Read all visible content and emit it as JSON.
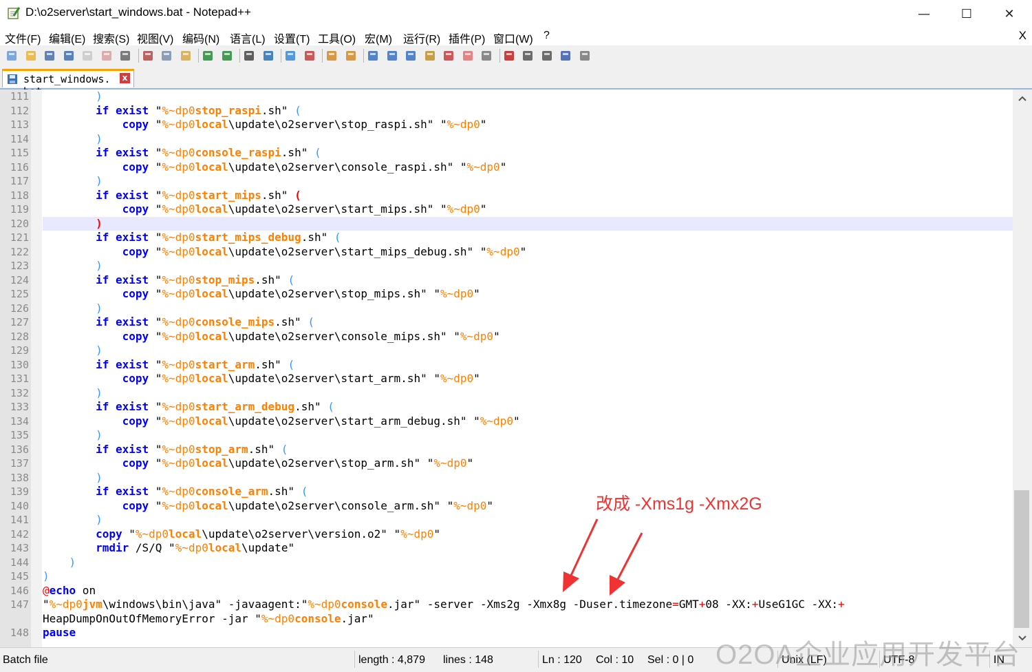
{
  "window": {
    "title": "D:\\o2server\\start_windows.bat - Notepad++",
    "app_icon": "notepadpp-icon",
    "controls": {
      "minimize": "—",
      "maximize": "☐",
      "close": "✕"
    }
  },
  "menu": {
    "items": [
      "文件(F)",
      "编辑(E)",
      "搜索(S)",
      "视图(V)",
      "编码(N)",
      "语言(L)",
      "设置(T)",
      "工具(O)",
      "宏(M)",
      "运行(R)",
      "插件(P)",
      "窗口(W)",
      "?"
    ],
    "close": "X"
  },
  "toolbar": {
    "icons": [
      "new-file-icon",
      "open-file-icon",
      "save-icon",
      "save-all-icon",
      "close-icon",
      "close-all-icon",
      "print-icon",
      "cut-icon",
      "copy-icon",
      "paste-icon",
      "undo-icon",
      "redo-icon",
      "find-icon",
      "replace-icon",
      "zoom-in-icon",
      "zoom-out-icon",
      "sync-vertical-icon",
      "sync-horizontal-icon",
      "word-wrap-icon",
      "show-all-chars-icon",
      "indent-guide-icon",
      "doc-map-icon",
      "function-list-icon",
      "folder-workspace-icon",
      "monitor-icon",
      "record-macro-icon",
      "stop-record-icon",
      "play-macro-icon",
      "run-macro-multiple-icon",
      "save-macro-icon"
    ]
  },
  "tab": {
    "label": "start_windows. bat",
    "close": "x"
  },
  "annotation": "改成 -Xms1g -Xmx2G",
  "watermark": "O2OA企业应用开发平台",
  "status": {
    "file_type": "Batch file",
    "length": "length : 4,879",
    "lines": "lines : 148",
    "ln": "Ln : 120",
    "col": "Col : 10",
    "sel": "Sel : 0 | 0",
    "eol": "Unix (LF)",
    "encoding": "UTF-8",
    "mode": "IN"
  },
  "colors": {
    "keyword": "#0000ff",
    "variable": "#ff8000",
    "operator": "#ff0000",
    "paren": "#3399ff",
    "annotation": "#f03232"
  },
  "editor": {
    "lines": [
      {
        "n": "111",
        "t": [
          [
            "",
            "        "
          ],
          [
            "p",
            ")"
          ]
        ]
      },
      {
        "n": "112",
        "t": [
          [
            "",
            "        "
          ],
          [
            "kw",
            "if exist"
          ],
          [
            "",
            " \""
          ],
          [
            "var",
            "%~dp0"
          ],
          [
            "varb",
            "stop_raspi"
          ],
          [
            "",
            ".sh\" "
          ],
          [
            "p",
            "("
          ]
        ]
      },
      {
        "n": "113",
        "t": [
          [
            "",
            "            "
          ],
          [
            "kw",
            "copy"
          ],
          [
            "",
            " \""
          ],
          [
            "var",
            "%~dp0"
          ],
          [
            "varb",
            "local"
          ],
          [
            "",
            "\\update\\o2server\\stop_raspi.sh\" \""
          ],
          [
            "var",
            "%~dp0"
          ],
          [
            "",
            "\""
          ]
        ]
      },
      {
        "n": "114",
        "t": [
          [
            "",
            "        "
          ],
          [
            "p",
            ")"
          ]
        ]
      },
      {
        "n": "115",
        "t": [
          [
            "",
            "        "
          ],
          [
            "kw",
            "if exist"
          ],
          [
            "",
            " \""
          ],
          [
            "var",
            "%~dp0"
          ],
          [
            "varb",
            "console_raspi"
          ],
          [
            "",
            ".sh\" "
          ],
          [
            "p",
            "("
          ]
        ]
      },
      {
        "n": "116",
        "t": [
          [
            "",
            "            "
          ],
          [
            "kw",
            "copy"
          ],
          [
            "",
            " \""
          ],
          [
            "var",
            "%~dp0"
          ],
          [
            "varb",
            "local"
          ],
          [
            "",
            "\\update\\o2server\\console_raspi.sh\" \""
          ],
          [
            "var",
            "%~dp0"
          ],
          [
            "",
            "\""
          ]
        ]
      },
      {
        "n": "117",
        "t": [
          [
            "",
            "        "
          ],
          [
            "p",
            ")"
          ]
        ]
      },
      {
        "n": "118",
        "t": [
          [
            "",
            "        "
          ],
          [
            "kw",
            "if exist"
          ],
          [
            "",
            " \""
          ],
          [
            "var",
            "%~dp0"
          ],
          [
            "varb",
            "start_mips"
          ],
          [
            "",
            ".sh\" "
          ],
          [
            "pr",
            "("
          ]
        ]
      },
      {
        "n": "119",
        "t": [
          [
            "",
            "            "
          ],
          [
            "kw",
            "copy"
          ],
          [
            "",
            " \""
          ],
          [
            "var",
            "%~dp0"
          ],
          [
            "varb",
            "local"
          ],
          [
            "",
            "\\update\\o2server\\start_mips.sh\" \""
          ],
          [
            "var",
            "%~dp0"
          ],
          [
            "",
            "\""
          ]
        ]
      },
      {
        "n": "120",
        "t": [
          [
            "",
            "        "
          ],
          [
            "pr",
            ")"
          ]
        ]
      },
      {
        "n": "121",
        "t": [
          [
            "",
            "        "
          ],
          [
            "kw",
            "if exist"
          ],
          [
            "",
            " \""
          ],
          [
            "var",
            "%~dp0"
          ],
          [
            "varb",
            "start_mips_debug"
          ],
          [
            "",
            ".sh\" "
          ],
          [
            "p",
            "("
          ]
        ]
      },
      {
        "n": "122",
        "t": [
          [
            "",
            "            "
          ],
          [
            "kw",
            "copy"
          ],
          [
            "",
            " \""
          ],
          [
            "var",
            "%~dp0"
          ],
          [
            "varb",
            "local"
          ],
          [
            "",
            "\\update\\o2server\\start_mips_debug.sh\" \""
          ],
          [
            "var",
            "%~dp0"
          ],
          [
            "",
            "\""
          ]
        ]
      },
      {
        "n": "123",
        "t": [
          [
            "",
            "        "
          ],
          [
            "p",
            ")"
          ]
        ]
      },
      {
        "n": "124",
        "t": [
          [
            "",
            "        "
          ],
          [
            "kw",
            "if exist"
          ],
          [
            "",
            " \""
          ],
          [
            "var",
            "%~dp0"
          ],
          [
            "varb",
            "stop_mips"
          ],
          [
            "",
            ".sh\" "
          ],
          [
            "p",
            "("
          ]
        ]
      },
      {
        "n": "125",
        "t": [
          [
            "",
            "            "
          ],
          [
            "kw",
            "copy"
          ],
          [
            "",
            " \""
          ],
          [
            "var",
            "%~dp0"
          ],
          [
            "varb",
            "local"
          ],
          [
            "",
            "\\update\\o2server\\stop_mips.sh\" \""
          ],
          [
            "var",
            "%~dp0"
          ],
          [
            "",
            "\""
          ]
        ]
      },
      {
        "n": "126",
        "t": [
          [
            "",
            "        "
          ],
          [
            "p",
            ")"
          ]
        ]
      },
      {
        "n": "127",
        "t": [
          [
            "",
            "        "
          ],
          [
            "kw",
            "if exist"
          ],
          [
            "",
            " \""
          ],
          [
            "var",
            "%~dp0"
          ],
          [
            "varb",
            "console_mips"
          ],
          [
            "",
            ".sh\" "
          ],
          [
            "p",
            "("
          ]
        ]
      },
      {
        "n": "128",
        "t": [
          [
            "",
            "            "
          ],
          [
            "kw",
            "copy"
          ],
          [
            "",
            " \""
          ],
          [
            "var",
            "%~dp0"
          ],
          [
            "varb",
            "local"
          ],
          [
            "",
            "\\update\\o2server\\console_mips.sh\" \""
          ],
          [
            "var",
            "%~dp0"
          ],
          [
            "",
            "\""
          ]
        ]
      },
      {
        "n": "129",
        "t": [
          [
            "",
            "        "
          ],
          [
            "p",
            ")"
          ]
        ]
      },
      {
        "n": "130",
        "t": [
          [
            "",
            "        "
          ],
          [
            "kw",
            "if exist"
          ],
          [
            "",
            " \""
          ],
          [
            "var",
            "%~dp0"
          ],
          [
            "varb",
            "start_arm"
          ],
          [
            "",
            ".sh\" "
          ],
          [
            "p",
            "("
          ]
        ]
      },
      {
        "n": "131",
        "t": [
          [
            "",
            "            "
          ],
          [
            "kw",
            "copy"
          ],
          [
            "",
            " \""
          ],
          [
            "var",
            "%~dp0"
          ],
          [
            "varb",
            "local"
          ],
          [
            "",
            "\\update\\o2server\\start_arm.sh\" \""
          ],
          [
            "var",
            "%~dp0"
          ],
          [
            "",
            "\""
          ]
        ]
      },
      {
        "n": "132",
        "t": [
          [
            "",
            "        "
          ],
          [
            "p",
            ")"
          ]
        ]
      },
      {
        "n": "133",
        "t": [
          [
            "",
            "        "
          ],
          [
            "kw",
            "if exist"
          ],
          [
            "",
            " \""
          ],
          [
            "var",
            "%~dp0"
          ],
          [
            "varb",
            "start_arm_debug"
          ],
          [
            "",
            ".sh\" "
          ],
          [
            "p",
            "("
          ]
        ]
      },
      {
        "n": "134",
        "t": [
          [
            "",
            "            "
          ],
          [
            "kw",
            "copy"
          ],
          [
            "",
            " \""
          ],
          [
            "var",
            "%~dp0"
          ],
          [
            "varb",
            "local"
          ],
          [
            "",
            "\\update\\o2server\\start_arm_debug.sh\" \""
          ],
          [
            "var",
            "%~dp0"
          ],
          [
            "",
            "\""
          ]
        ]
      },
      {
        "n": "135",
        "t": [
          [
            "",
            "        "
          ],
          [
            "p",
            ")"
          ]
        ]
      },
      {
        "n": "136",
        "t": [
          [
            "",
            "        "
          ],
          [
            "kw",
            "if exist"
          ],
          [
            "",
            " \""
          ],
          [
            "var",
            "%~dp0"
          ],
          [
            "varb",
            "stop_arm"
          ],
          [
            "",
            ".sh\" "
          ],
          [
            "p",
            "("
          ]
        ]
      },
      {
        "n": "137",
        "t": [
          [
            "",
            "            "
          ],
          [
            "kw",
            "copy"
          ],
          [
            "",
            " \""
          ],
          [
            "var",
            "%~dp0"
          ],
          [
            "varb",
            "local"
          ],
          [
            "",
            "\\update\\o2server\\stop_arm.sh\" \""
          ],
          [
            "var",
            "%~dp0"
          ],
          [
            "",
            "\""
          ]
        ]
      },
      {
        "n": "138",
        "t": [
          [
            "",
            "        "
          ],
          [
            "p",
            ")"
          ]
        ]
      },
      {
        "n": "139",
        "t": [
          [
            "",
            "        "
          ],
          [
            "kw",
            "if exist"
          ],
          [
            "",
            " \""
          ],
          [
            "var",
            "%~dp0"
          ],
          [
            "varb",
            "console_arm"
          ],
          [
            "",
            ".sh\" "
          ],
          [
            "p",
            "("
          ]
        ]
      },
      {
        "n": "140",
        "t": [
          [
            "",
            "            "
          ],
          [
            "kw",
            "copy"
          ],
          [
            "",
            " \""
          ],
          [
            "var",
            "%~dp0"
          ],
          [
            "varb",
            "local"
          ],
          [
            "",
            "\\update\\o2server\\console_arm.sh\" \""
          ],
          [
            "var",
            "%~dp0"
          ],
          [
            "",
            "\""
          ]
        ]
      },
      {
        "n": "141",
        "t": [
          [
            "",
            "        "
          ],
          [
            "p",
            ")"
          ]
        ]
      },
      {
        "n": "142",
        "t": [
          [
            "",
            "        "
          ],
          [
            "kw",
            "copy"
          ],
          [
            "",
            " \""
          ],
          [
            "var",
            "%~dp0"
          ],
          [
            "varb",
            "local"
          ],
          [
            "",
            "\\update\\o2server\\version.o2\" \""
          ],
          [
            "var",
            "%~dp0"
          ],
          [
            "",
            "\""
          ]
        ]
      },
      {
        "n": "143",
        "t": [
          [
            "",
            "        "
          ],
          [
            "kw",
            "rmdir"
          ],
          [
            "",
            " /S/Q \""
          ],
          [
            "var",
            "%~dp0"
          ],
          [
            "varb",
            "local"
          ],
          [
            "",
            "\\update\""
          ]
        ]
      },
      {
        "n": "144",
        "t": [
          [
            "",
            "    "
          ],
          [
            "p",
            ")"
          ]
        ]
      },
      {
        "n": "145",
        "t": [
          [
            "p",
            ")"
          ]
        ]
      },
      {
        "n": "146",
        "t": [
          [
            "op",
            "@"
          ],
          [
            "kw",
            "echo"
          ],
          [
            "",
            " on"
          ]
        ]
      },
      {
        "n": "147",
        "t": [
          [
            "",
            "\""
          ],
          [
            "var",
            "%~dp0"
          ],
          [
            "varb",
            "jvm"
          ],
          [
            "",
            "\\windows\\bin\\java\" -javaagent:\""
          ],
          [
            "var",
            "%~dp0"
          ],
          [
            "varb",
            "console"
          ],
          [
            "",
            ".jar\" -server -Xms2g -Xmx8g -Duser.timezone"
          ],
          [
            "op",
            "="
          ],
          [
            "",
            "GMT"
          ],
          [
            "op",
            "+"
          ],
          [
            "",
            "08 -XX:"
          ],
          [
            "op",
            "+"
          ],
          [
            "",
            "UseG1GC -XX:"
          ],
          [
            "op",
            "+"
          ]
        ]
      },
      {
        "n": "",
        "t": [
          [
            "",
            "HeapDumpOnOutOfMemoryError -jar \""
          ],
          [
            "var",
            "%~dp0"
          ],
          [
            "varb",
            "console"
          ],
          [
            "",
            ".jar\""
          ]
        ]
      },
      {
        "n": "148",
        "t": [
          [
            "kw",
            "pause"
          ]
        ]
      }
    ]
  }
}
